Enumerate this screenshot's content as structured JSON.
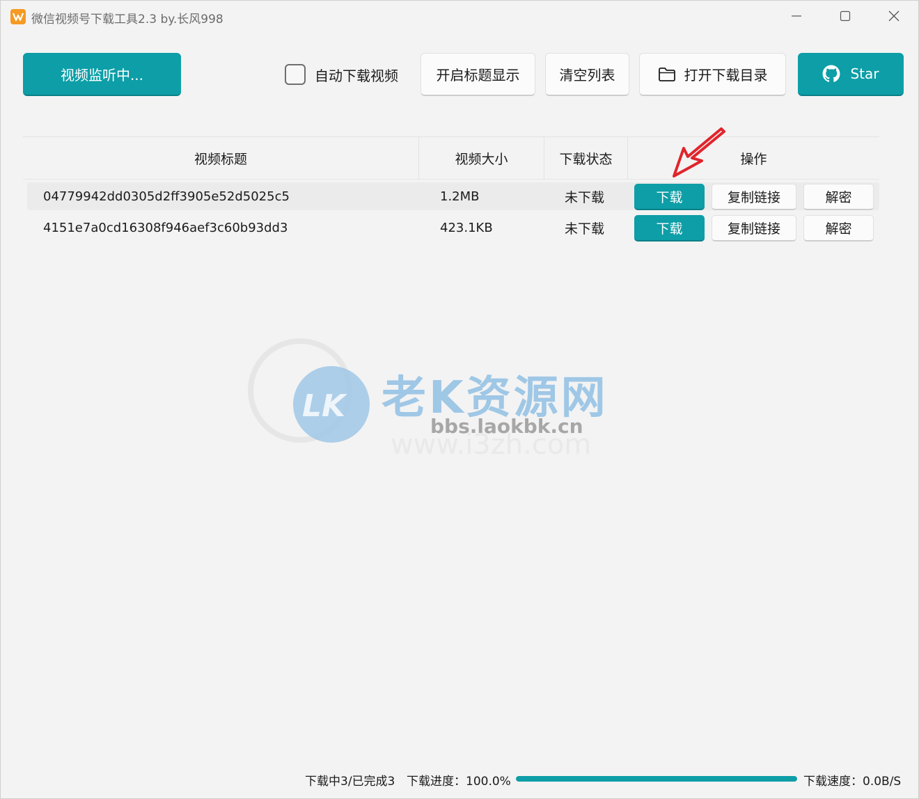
{
  "window": {
    "title": "微信视频号下载工具2.3 by.长风998",
    "icon": "app-icon",
    "controls": [
      "minimize-icon",
      "maximize-icon",
      "close-icon"
    ]
  },
  "toolbar": {
    "monitor_label": "视频监听中...",
    "auto_download_label": "自动下载视频",
    "auto_download_checked": false,
    "show_title_label": "开启标题显示",
    "clear_list_label": "清空列表",
    "open_dir_label": "打开下载目录",
    "star_label": "Star"
  },
  "table": {
    "headers": {
      "title": "视频标题",
      "size": "视频大小",
      "status": "下载状态",
      "ops": "操作"
    },
    "rows": [
      {
        "title": "04779942dd0305d2ff3905e52d5025c5",
        "size": "1.2MB",
        "status": "未下载",
        "download": "下载",
        "copy": "复制链接",
        "decrypt": "解密"
      },
      {
        "title": "4151e7a0cd16308f946aef3c60b93dd3",
        "size": "423.1KB",
        "status": "未下载",
        "download": "下载",
        "copy": "复制链接",
        "decrypt": "解密"
      }
    ]
  },
  "watermark": {
    "logo_text": "LK",
    "name": "老K资源网",
    "url1": "bbs.laokbk.cn",
    "url2": "www.i3zh.com"
  },
  "statusbar": {
    "count_text": "下载中3/已完成3",
    "progress_label": "下载进度：100.0%",
    "progress_value": 1.0,
    "speed_text": "下载速度：0.0B/S"
  },
  "colors": {
    "accent": "#0d9ea7",
    "background": "#f3f3f3",
    "annotation_arrow": "#e0242b"
  }
}
